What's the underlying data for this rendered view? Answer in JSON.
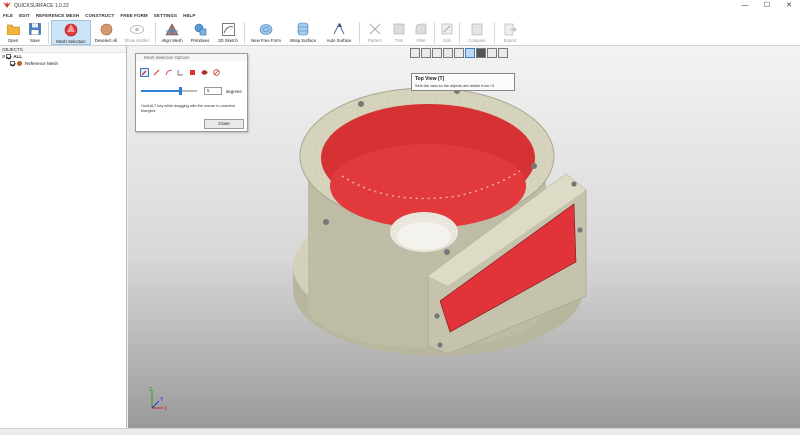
{
  "window": {
    "title": "QUICKSURFACE 1.0.22",
    "controls": [
      "—",
      "☐",
      "✕"
    ]
  },
  "menu": [
    "FILE",
    "EDIT",
    "REFERENCE MESH",
    "CONSTRUCT",
    "FREE FORM",
    "SETTINGS",
    "HELP"
  ],
  "ribbon": {
    "open": "Open",
    "save": "Save",
    "mesh_selection": "Mesh Selection",
    "deselect_all": "Deselect All",
    "show_hidden": "Show Hidden",
    "align_mesh": "Align Mesh",
    "primitives": "Primitives",
    "sketch_2d": "2D Sketch",
    "new_free_form": "New Free Form",
    "wrap_surface": "Wrap Surface",
    "auto_surface": "Auto Surface",
    "pattern": "Pattern",
    "trim": "Trim",
    "fillet": "Fillet",
    "edit": "Edit",
    "compare": "Compare",
    "export": "Export"
  },
  "objects": {
    "header": "OBJECTS",
    "root": "ALL",
    "items": [
      "Reference Mesh"
    ]
  },
  "dialog": {
    "title": "Mesh Selection Options",
    "degrees_value": "5",
    "degrees_label": "degrees",
    "slider_fraction": 0.7,
    "note": "Hold ALT key while dragging with the mouse to unselect triangles",
    "close": "Close"
  },
  "tooltip": {
    "title": "Top View     (T)",
    "desc": "Sets the view so the objects are visible from +Z"
  },
  "triad": {
    "x": "X",
    "y": "Y",
    "z": "Z"
  },
  "colors": {
    "selection": "#e0343a",
    "model": "#d6d3bd",
    "accent": "#2d7fd8"
  }
}
